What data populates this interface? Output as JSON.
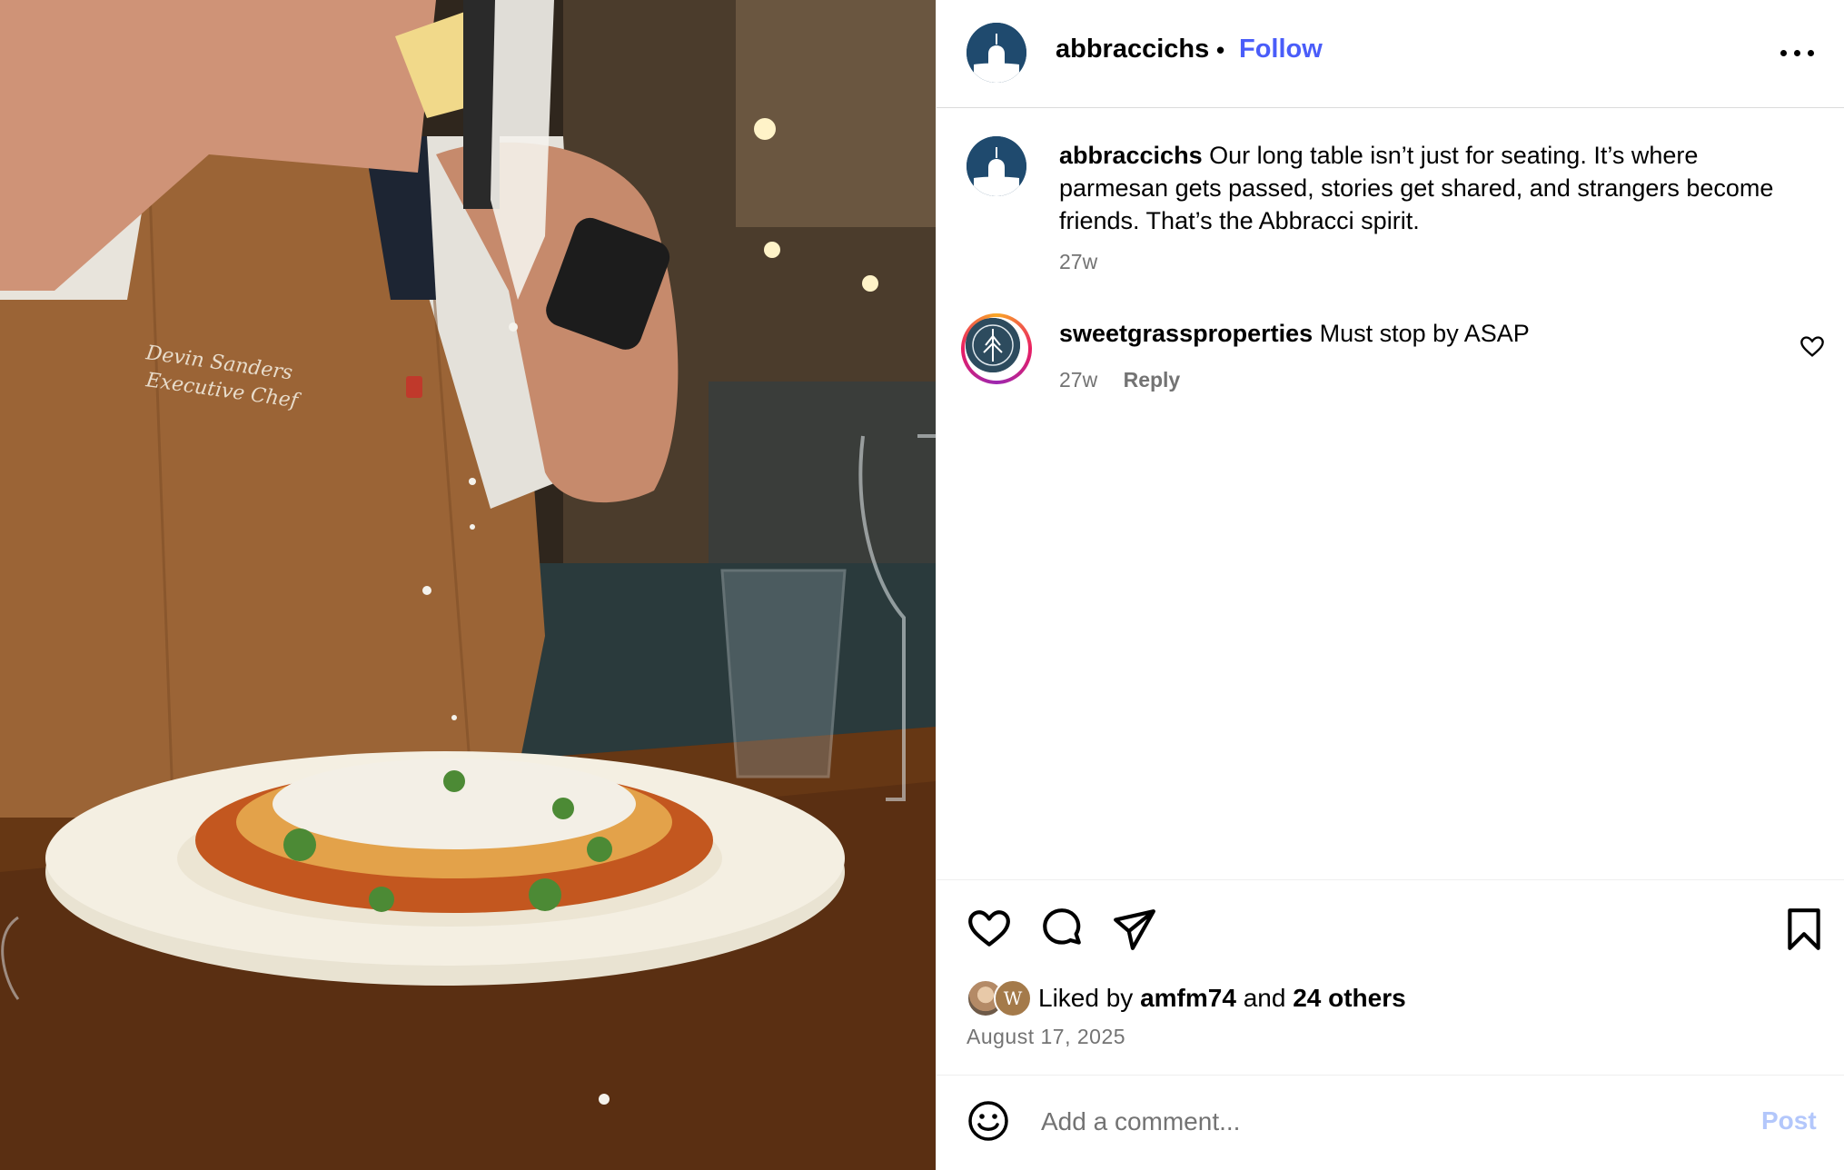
{
  "post": {
    "username": "abbraccichs",
    "dot": "•",
    "follow_label": "Follow",
    "more_icon": "more-horizontal-icon"
  },
  "caption": {
    "username": "abbraccichs",
    "text": "Our long table isn’t just for seating. It’s where parmesan gets passed, stories get shared, and strangers become friends. That’s the Abbracci spirit.",
    "time": "27w"
  },
  "comments": [
    {
      "username": "sweetgrassproperties",
      "text": "Must stop by ASAP",
      "time": "27w",
      "reply_label": "Reply"
    }
  ],
  "likes": {
    "prefix": "Liked by",
    "user": "amfm74",
    "and": "and",
    "others": "24 others",
    "avatar2_letter": "W"
  },
  "date": "August 17, 2025",
  "comment_box": {
    "placeholder": "Add a comment...",
    "post_label": "Post"
  },
  "colors": {
    "follow": "#4a5df9",
    "post_disabled": "#b3c7fb",
    "muted_text": "#737373",
    "avatar_bg": "#1f4a6e"
  }
}
